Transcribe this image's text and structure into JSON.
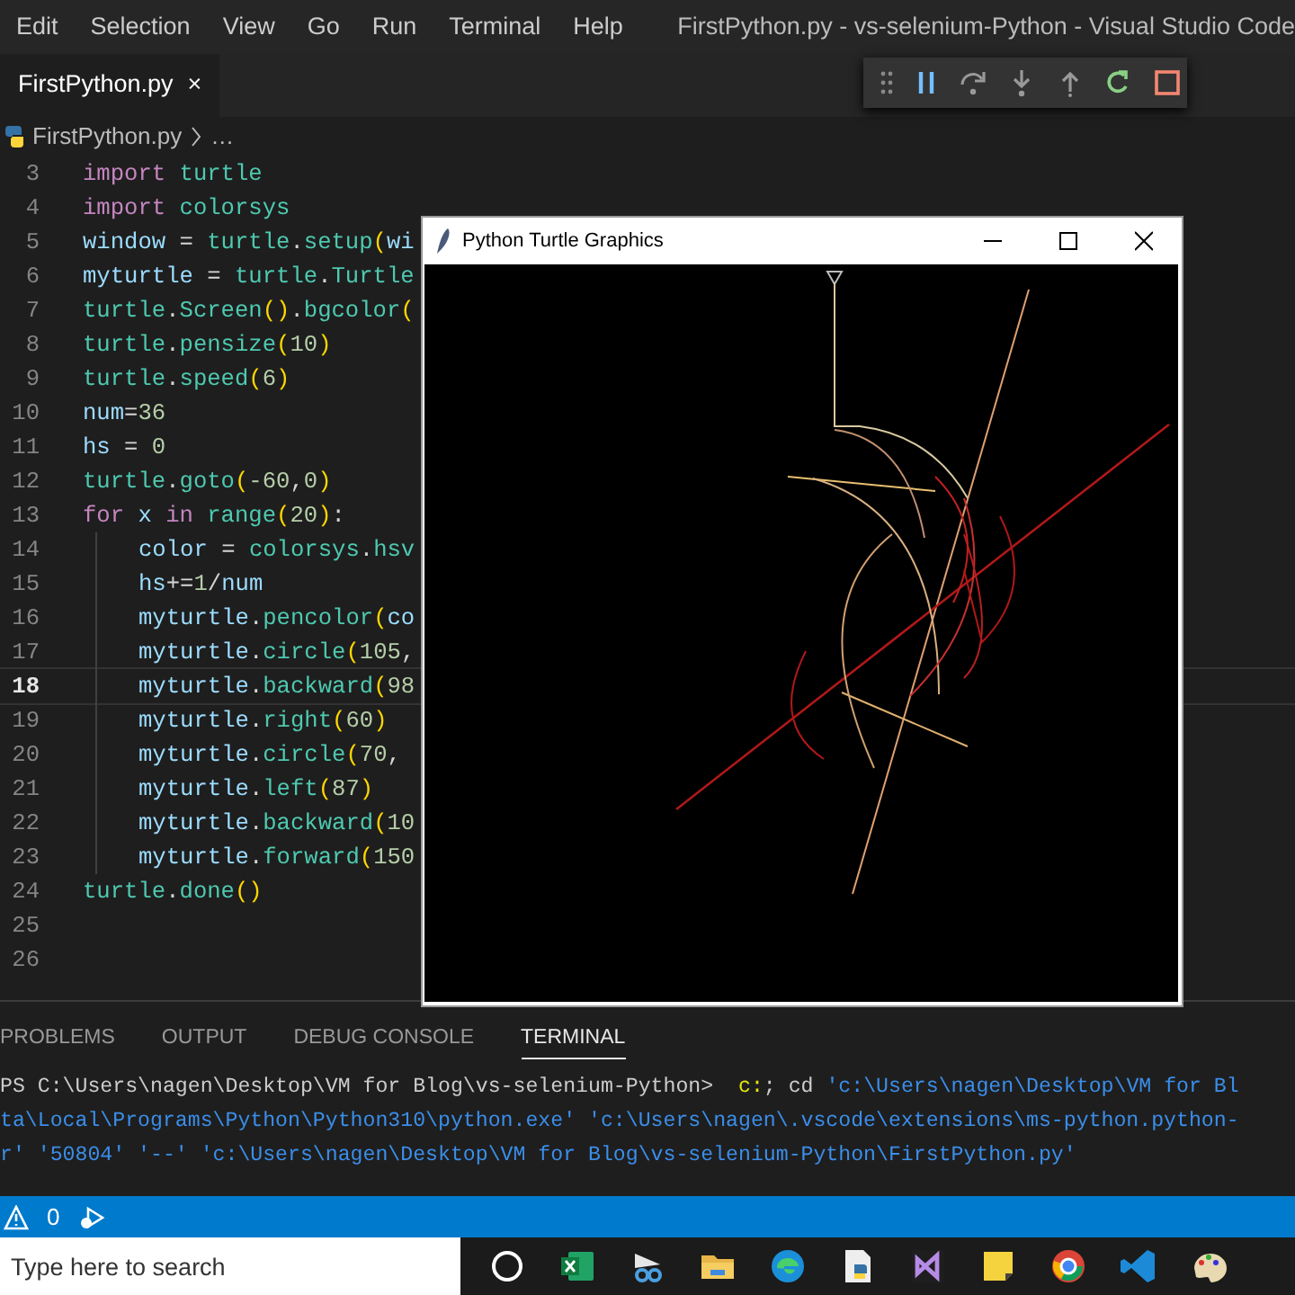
{
  "menu": [
    "Edit",
    "Selection",
    "View",
    "Go",
    "Run",
    "Terminal",
    "Help"
  ],
  "window_title": "FirstPython.py - vs-selenium-Python - Visual Studio Code",
  "editor_tabs": [
    {
      "label": "FirstPython.py",
      "selected": true,
      "close": "×"
    }
  ],
  "breadcrumb": [
    "FirstPython.py",
    "…"
  ],
  "editor_lines": [
    {
      "number": "3",
      "current": false,
      "tokens": [
        {
          "text": "import ",
          "kind": "kw"
        },
        {
          "text": "turtle",
          "kind": "mod"
        }
      ]
    },
    {
      "number": "4",
      "current": false,
      "tokens": [
        {
          "text": "import ",
          "kind": "kw"
        },
        {
          "text": "colorsys",
          "kind": "mod"
        }
      ]
    },
    {
      "number": "5",
      "current": false,
      "tokens": [
        {
          "text": "window",
          "kind": "var"
        },
        {
          "text": " = ",
          "kind": "op"
        },
        {
          "text": "turtle",
          "kind": "mod"
        },
        {
          "text": ".",
          "kind": "op"
        },
        {
          "text": "setup",
          "kind": "fn"
        },
        {
          "text": "(",
          "kind": "paren"
        },
        {
          "text": "wi",
          "kind": "var"
        }
      ]
    },
    {
      "number": "6",
      "current": false,
      "tokens": [
        {
          "text": "myturtle",
          "kind": "var"
        },
        {
          "text": " = ",
          "kind": "op"
        },
        {
          "text": "turtle",
          "kind": "mod"
        },
        {
          "text": ".",
          "kind": "op"
        },
        {
          "text": "Turtle",
          "kind": "mod"
        }
      ]
    },
    {
      "number": "7",
      "current": false,
      "tokens": [
        {
          "text": "turtle",
          "kind": "mod"
        },
        {
          "text": ".",
          "kind": "op"
        },
        {
          "text": "Screen",
          "kind": "fn"
        },
        {
          "text": "()",
          "kind": "paren"
        },
        {
          "text": ".",
          "kind": "op"
        },
        {
          "text": "bgcolor",
          "kind": "fn"
        },
        {
          "text": "(",
          "kind": "paren"
        }
      ]
    },
    {
      "number": "8",
      "current": false,
      "tokens": [
        {
          "text": "turtle",
          "kind": "mod"
        },
        {
          "text": ".",
          "kind": "op"
        },
        {
          "text": "pensize",
          "kind": "fn"
        },
        {
          "text": "(",
          "kind": "paren"
        },
        {
          "text": "10",
          "kind": "num"
        },
        {
          "text": ")",
          "kind": "paren"
        }
      ]
    },
    {
      "number": "9",
      "current": false,
      "tokens": [
        {
          "text": "turtle",
          "kind": "mod"
        },
        {
          "text": ".",
          "kind": "op"
        },
        {
          "text": "speed",
          "kind": "fn"
        },
        {
          "text": "(",
          "kind": "paren"
        },
        {
          "text": "6",
          "kind": "num"
        },
        {
          "text": ")",
          "kind": "paren"
        }
      ]
    },
    {
      "number": "10",
      "current": false,
      "tokens": [
        {
          "text": "num",
          "kind": "var"
        },
        {
          "text": "=",
          "kind": "op"
        },
        {
          "text": "36",
          "kind": "num"
        }
      ]
    },
    {
      "number": "11",
      "current": false,
      "tokens": [
        {
          "text": "hs",
          "kind": "var"
        },
        {
          "text": " = ",
          "kind": "op"
        },
        {
          "text": "0",
          "kind": "num"
        }
      ]
    },
    {
      "number": "12",
      "current": false,
      "tokens": [
        {
          "text": "turtle",
          "kind": "mod"
        },
        {
          "text": ".",
          "kind": "op"
        },
        {
          "text": "goto",
          "kind": "fn"
        },
        {
          "text": "(",
          "kind": "paren"
        },
        {
          "text": "-60",
          "kind": "num"
        },
        {
          "text": ",",
          "kind": "op"
        },
        {
          "text": "0",
          "kind": "num"
        },
        {
          "text": ")",
          "kind": "paren"
        }
      ]
    },
    {
      "number": "13",
      "current": false,
      "tokens": [
        {
          "text": "for ",
          "kind": "kw"
        },
        {
          "text": "x ",
          "kind": "var"
        },
        {
          "text": "in ",
          "kind": "kw"
        },
        {
          "text": "range",
          "kind": "mod"
        },
        {
          "text": "(",
          "kind": "paren"
        },
        {
          "text": "20",
          "kind": "num"
        },
        {
          "text": ")",
          "kind": "paren"
        },
        {
          "text": ":",
          "kind": "op"
        }
      ],
      "children": [
        {
          "number": "14",
          "current": false,
          "tokens": [
            {
              "text": "color",
              "kind": "var"
            },
            {
              "text": " = ",
              "kind": "op"
            },
            {
              "text": "colorsys",
              "kind": "mod"
            },
            {
              "text": ".",
              "kind": "op"
            },
            {
              "text": "hsv",
              "kind": "fn"
            }
          ]
        },
        {
          "number": "15",
          "current": false,
          "tokens": [
            {
              "text": "hs",
              "kind": "var"
            },
            {
              "text": "+=",
              "kind": "op"
            },
            {
              "text": "1",
              "kind": "num"
            },
            {
              "text": "/",
              "kind": "op"
            },
            {
              "text": "num",
              "kind": "var"
            }
          ]
        },
        {
          "number": "16",
          "current": false,
          "tokens": [
            {
              "text": "myturtle",
              "kind": "var"
            },
            {
              "text": ".",
              "kind": "op"
            },
            {
              "text": "pencolor",
              "kind": "fn"
            },
            {
              "text": "(",
              "kind": "paren"
            },
            {
              "text": "co",
              "kind": "var"
            }
          ]
        },
        {
          "number": "17",
          "current": false,
          "tokens": [
            {
              "text": "myturtle",
              "kind": "var"
            },
            {
              "text": ".",
              "kind": "op"
            },
            {
              "text": "circle",
              "kind": "fn"
            },
            {
              "text": "(",
              "kind": "paren"
            },
            {
              "text": "105",
              "kind": "num"
            },
            {
              "text": ",",
              "kind": "op"
            }
          ]
        },
        {
          "number": "18",
          "current": true,
          "tokens": [
            {
              "text": "myturtle",
              "kind": "var"
            },
            {
              "text": ".",
              "kind": "op"
            },
            {
              "text": "backward",
              "kind": "fn"
            },
            {
              "text": "(",
              "kind": "paren"
            },
            {
              "text": "98",
              "kind": "num"
            }
          ]
        },
        {
          "number": "19",
          "current": false,
          "tokens": [
            {
              "text": "myturtle",
              "kind": "var"
            },
            {
              "text": ".",
              "kind": "op"
            },
            {
              "text": "right",
              "kind": "fn"
            },
            {
              "text": "(",
              "kind": "paren"
            },
            {
              "text": "60",
              "kind": "num"
            },
            {
              "text": ")",
              "kind": "paren"
            }
          ]
        },
        {
          "number": "20",
          "current": false,
          "tokens": [
            {
              "text": "myturtle",
              "kind": "var"
            },
            {
              "text": ".",
              "kind": "op"
            },
            {
              "text": "circle",
              "kind": "fn"
            },
            {
              "text": "(",
              "kind": "paren"
            },
            {
              "text": "70",
              "kind": "num"
            },
            {
              "text": ",",
              "kind": "op"
            }
          ]
        },
        {
          "number": "21",
          "current": false,
          "tokens": [
            {
              "text": "myturtle",
              "kind": "var"
            },
            {
              "text": ".",
              "kind": "op"
            },
            {
              "text": "left",
              "kind": "fn"
            },
            {
              "text": "(",
              "kind": "paren"
            },
            {
              "text": "87",
              "kind": "num"
            },
            {
              "text": ")",
              "kind": "paren"
            }
          ]
        },
        {
          "number": "22",
          "current": false,
          "tokens": [
            {
              "text": "myturtle",
              "kind": "var"
            },
            {
              "text": ".",
              "kind": "op"
            },
            {
              "text": "backward",
              "kind": "fn"
            },
            {
              "text": "(",
              "kind": "paren"
            },
            {
              "text": "10",
              "kind": "num"
            }
          ]
        },
        {
          "number": "23",
          "current": false,
          "tokens": [
            {
              "text": "myturtle",
              "kind": "var"
            },
            {
              "text": ".",
              "kind": "op"
            },
            {
              "text": "forward",
              "kind": "fn"
            },
            {
              "text": "(",
              "kind": "paren"
            },
            {
              "text": "150",
              "kind": "num"
            }
          ]
        }
      ]
    },
    {
      "number": "24",
      "current": false,
      "tokens": [
        {
          "text": "turtle",
          "kind": "mod"
        },
        {
          "text": ".",
          "kind": "op"
        },
        {
          "text": "done",
          "kind": "fn"
        },
        {
          "text": "()",
          "kind": "paren"
        }
      ]
    },
    {
      "number": "25",
      "current": false
    },
    {
      "number": "26",
      "current": false
    }
  ],
  "turtle_window": {
    "title": "Python Turtle Graphics"
  },
  "panel_tabs": [
    {
      "label": "PROBLEMS",
      "selected": false
    },
    {
      "label": "OUTPUT",
      "selected": false
    },
    {
      "label": "DEBUG CONSOLE",
      "selected": false
    },
    {
      "label": "TERMINAL",
      "selected": true
    }
  ],
  "terminal_lines": [
    [
      {
        "text": "PS C:\\Users\\nagen\\Desktop\\VM for Blog\\vs-selenium-Python>  ",
        "kind": "plain"
      },
      {
        "text": "c:",
        "kind": "cmd"
      },
      {
        "text": "; cd ",
        "kind": "plain"
      },
      {
        "text": "'c:\\Users\\nagen\\Desktop\\VM for Bl",
        "kind": "str"
      }
    ],
    [
      {
        "text": "ta\\Local\\Programs\\Python\\Python310\\python.exe' 'c:\\Users\\nagen\\.vscode\\extensions\\ms-python.python-",
        "kind": "str"
      }
    ],
    [
      {
        "text": "r' '50804' '--' 'c:\\Users\\nagen\\Desktop\\VM for Blog\\vs-selenium-Python\\FirstPython.py'",
        "kind": "str"
      }
    ]
  ],
  "status_bar": {
    "problems": "0"
  },
  "taskbar": {
    "search_placeholder": "Type here to search"
  }
}
